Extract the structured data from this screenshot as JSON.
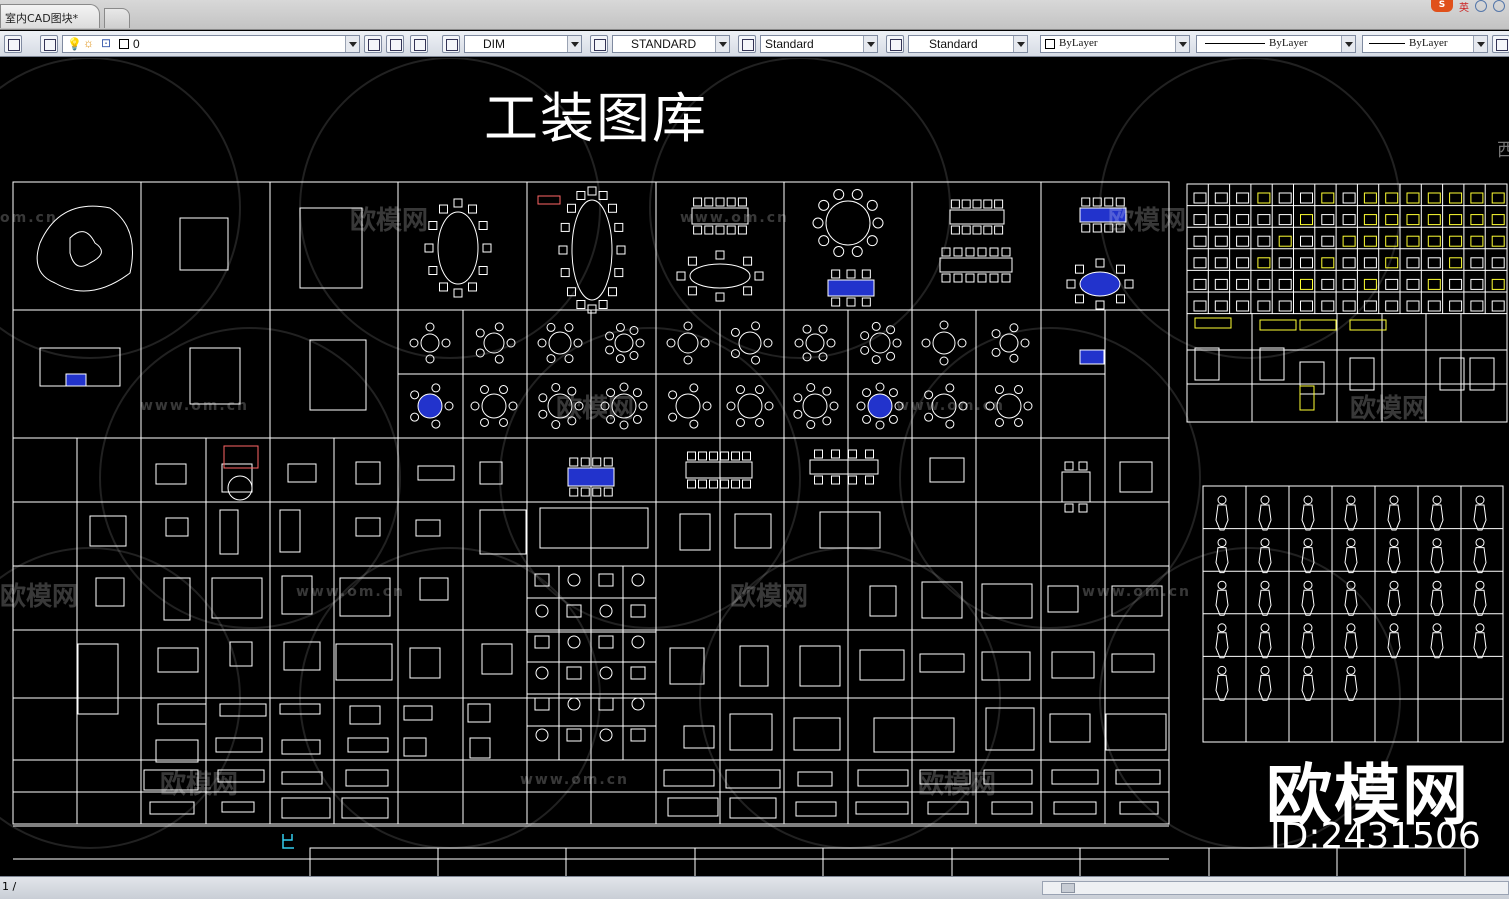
{
  "window": {
    "doc_tab_title": "室内CAD图块*",
    "top_right_text": "英"
  },
  "toolbar": {
    "layer_value": "0",
    "text_style": "DIM",
    "dim_style": "STANDARD",
    "table_style": "Standard",
    "multileader_style": "Standard",
    "color": "ByLayer",
    "linetype": "ByLayer",
    "lineweight": "ByLayer"
  },
  "drawing": {
    "title": "工装图库",
    "edge_char": "西"
  },
  "watermark": {
    "brand": "欧模网",
    "url": "www.om.cn",
    "url_short": "om.cn",
    "id": "ID:2431506"
  },
  "status": {
    "coord_text": "1 /"
  },
  "colors": {
    "background": "#000000",
    "line": "#ffffff",
    "accent_blue": "#2233cc",
    "accent_red": "#ff6666",
    "accent_yellow": "#ffff33",
    "accent_cyan": "#33ccee"
  }
}
